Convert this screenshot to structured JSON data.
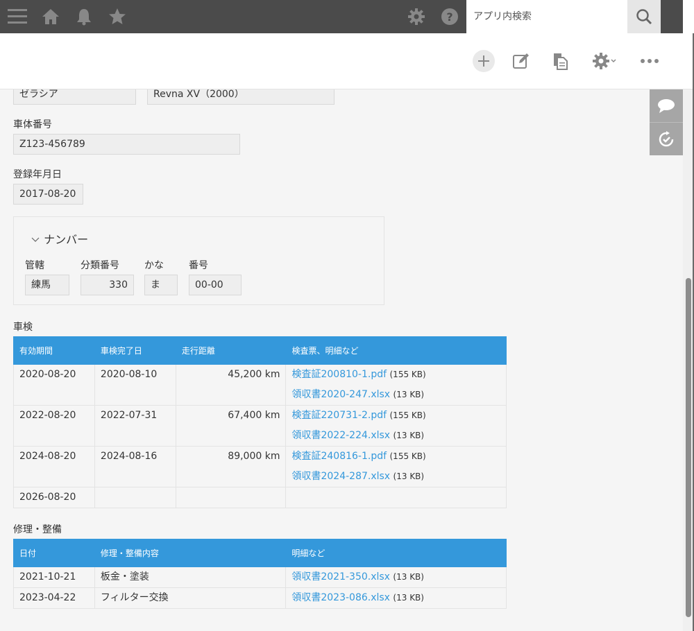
{
  "header": {
    "search_placeholder": "アプリ内検索"
  },
  "record": {
    "maker": "ゼラシア",
    "model": "Revna XV（2000）",
    "chassis_label": "車体番号",
    "chassis_value": "Z123-456789",
    "reg_date_label": "登録年月日",
    "reg_date_value": "2017-08-20",
    "plate": {
      "title": "ナンバー",
      "office_label": "管轄",
      "office_value": "練馬",
      "class_label": "分類番号",
      "class_value": "330",
      "kana_label": "かな",
      "kana_value": "ま",
      "number_label": "番号",
      "number_value": "00-00"
    }
  },
  "inspection": {
    "title": "車検",
    "headers": [
      "有効期間",
      "車検完了日",
      "走行距離",
      "検査票、明細など"
    ],
    "rows": [
      {
        "valid": "2020-08-20",
        "done": "2020-08-10",
        "distance": "45,200 km",
        "files": [
          {
            "name": "検査証200810-1.pdf",
            "size": "(155 KB)"
          },
          {
            "name": "領収書2020-247.xlsx",
            "size": "(13 KB)"
          }
        ]
      },
      {
        "valid": "2022-08-20",
        "done": "2022-07-31",
        "distance": "67,400 km",
        "files": [
          {
            "name": "検査証220731-2.pdf",
            "size": "(155 KB)"
          },
          {
            "name": "領収書2022-224.xlsx",
            "size": "(13 KB)"
          }
        ]
      },
      {
        "valid": "2024-08-20",
        "done": "2024-08-16",
        "distance": "89,000 km",
        "files": [
          {
            "name": "検査証240816-1.pdf",
            "size": "(155 KB)"
          },
          {
            "name": "領収書2024-287.xlsx",
            "size": "(13 KB)"
          }
        ]
      },
      {
        "valid": "2026-08-20",
        "done": "",
        "distance": "",
        "files": []
      }
    ]
  },
  "repair": {
    "title": "修理・整備",
    "headers": [
      "日付",
      "修理・整備内容",
      "明細など"
    ],
    "rows": [
      {
        "date": "2021-10-21",
        "content": "板金・塗装",
        "file": {
          "name": "領収書2021-350.xlsx",
          "size": "(13 KB)"
        }
      },
      {
        "date": "2023-04-22",
        "content": "フィルター交換",
        "file": {
          "name": "領収書2023-086.xlsx",
          "size": "(13 KB)"
        }
      }
    ]
  },
  "colors": {
    "header_bg": "#4b4b4b",
    "accent": "#3498db",
    "side_panel": "#a6a6a6"
  },
  "icons": [
    "menu-icon",
    "home-icon",
    "bell-icon",
    "star-icon",
    "gear-icon",
    "help-icon",
    "search-icon",
    "add-icon",
    "edit-icon",
    "copy-icon",
    "settings-icon",
    "more-icon",
    "comment-icon",
    "history-icon"
  ]
}
